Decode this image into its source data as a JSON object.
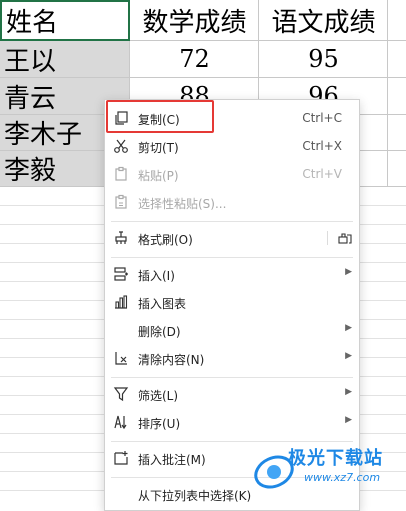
{
  "sheet": {
    "headers": [
      "姓名",
      "数学成绩",
      "语文成绩"
    ],
    "rows": [
      {
        "name": "王以",
        "math": "72",
        "chinese": "95"
      },
      {
        "name": "青云",
        "math": "88",
        "chinese": "96"
      },
      {
        "name": "李木子",
        "math": "",
        "chinese": ""
      },
      {
        "name": "李毅",
        "math": "",
        "chinese": ""
      }
    ]
  },
  "menu": {
    "copy": {
      "label": "复制(C)",
      "shortcut": "Ctrl+C",
      "icon": "copy-icon"
    },
    "cut": {
      "label": "剪切(T)",
      "shortcut": "Ctrl+X",
      "icon": "scissors-icon"
    },
    "paste": {
      "label": "粘贴(P)",
      "shortcut": "Ctrl+V",
      "icon": "paste-icon"
    },
    "paste_special": {
      "label": "选择性粘贴(S)...",
      "icon": "paste-special-icon"
    },
    "format_painter": {
      "label": "格式刷(O)",
      "icon": "format-painter-icon"
    },
    "insert": {
      "label": "插入(I)",
      "icon": "insert-icon"
    },
    "insert_chart": {
      "label": "插入图表",
      "icon": "chart-icon"
    },
    "delete": {
      "label": "删除(D)"
    },
    "clear": {
      "label": "清除内容(N)",
      "icon": "eraser-icon"
    },
    "filter": {
      "label": "筛选(L)",
      "icon": "filter-icon"
    },
    "sort": {
      "label": "排序(U)",
      "icon": "sort-icon"
    },
    "insert_comment": {
      "label": "插入批注(M)",
      "icon": "comment-icon"
    },
    "pick_from_list": {
      "label": "从下拉列表中选择(K)"
    }
  },
  "watermark": {
    "text": "极光下载站",
    "url": "www.xz7.com"
  },
  "colors": {
    "selection_border": "#217346",
    "highlight": "#e53935",
    "watermark": "#1e88e5"
  }
}
